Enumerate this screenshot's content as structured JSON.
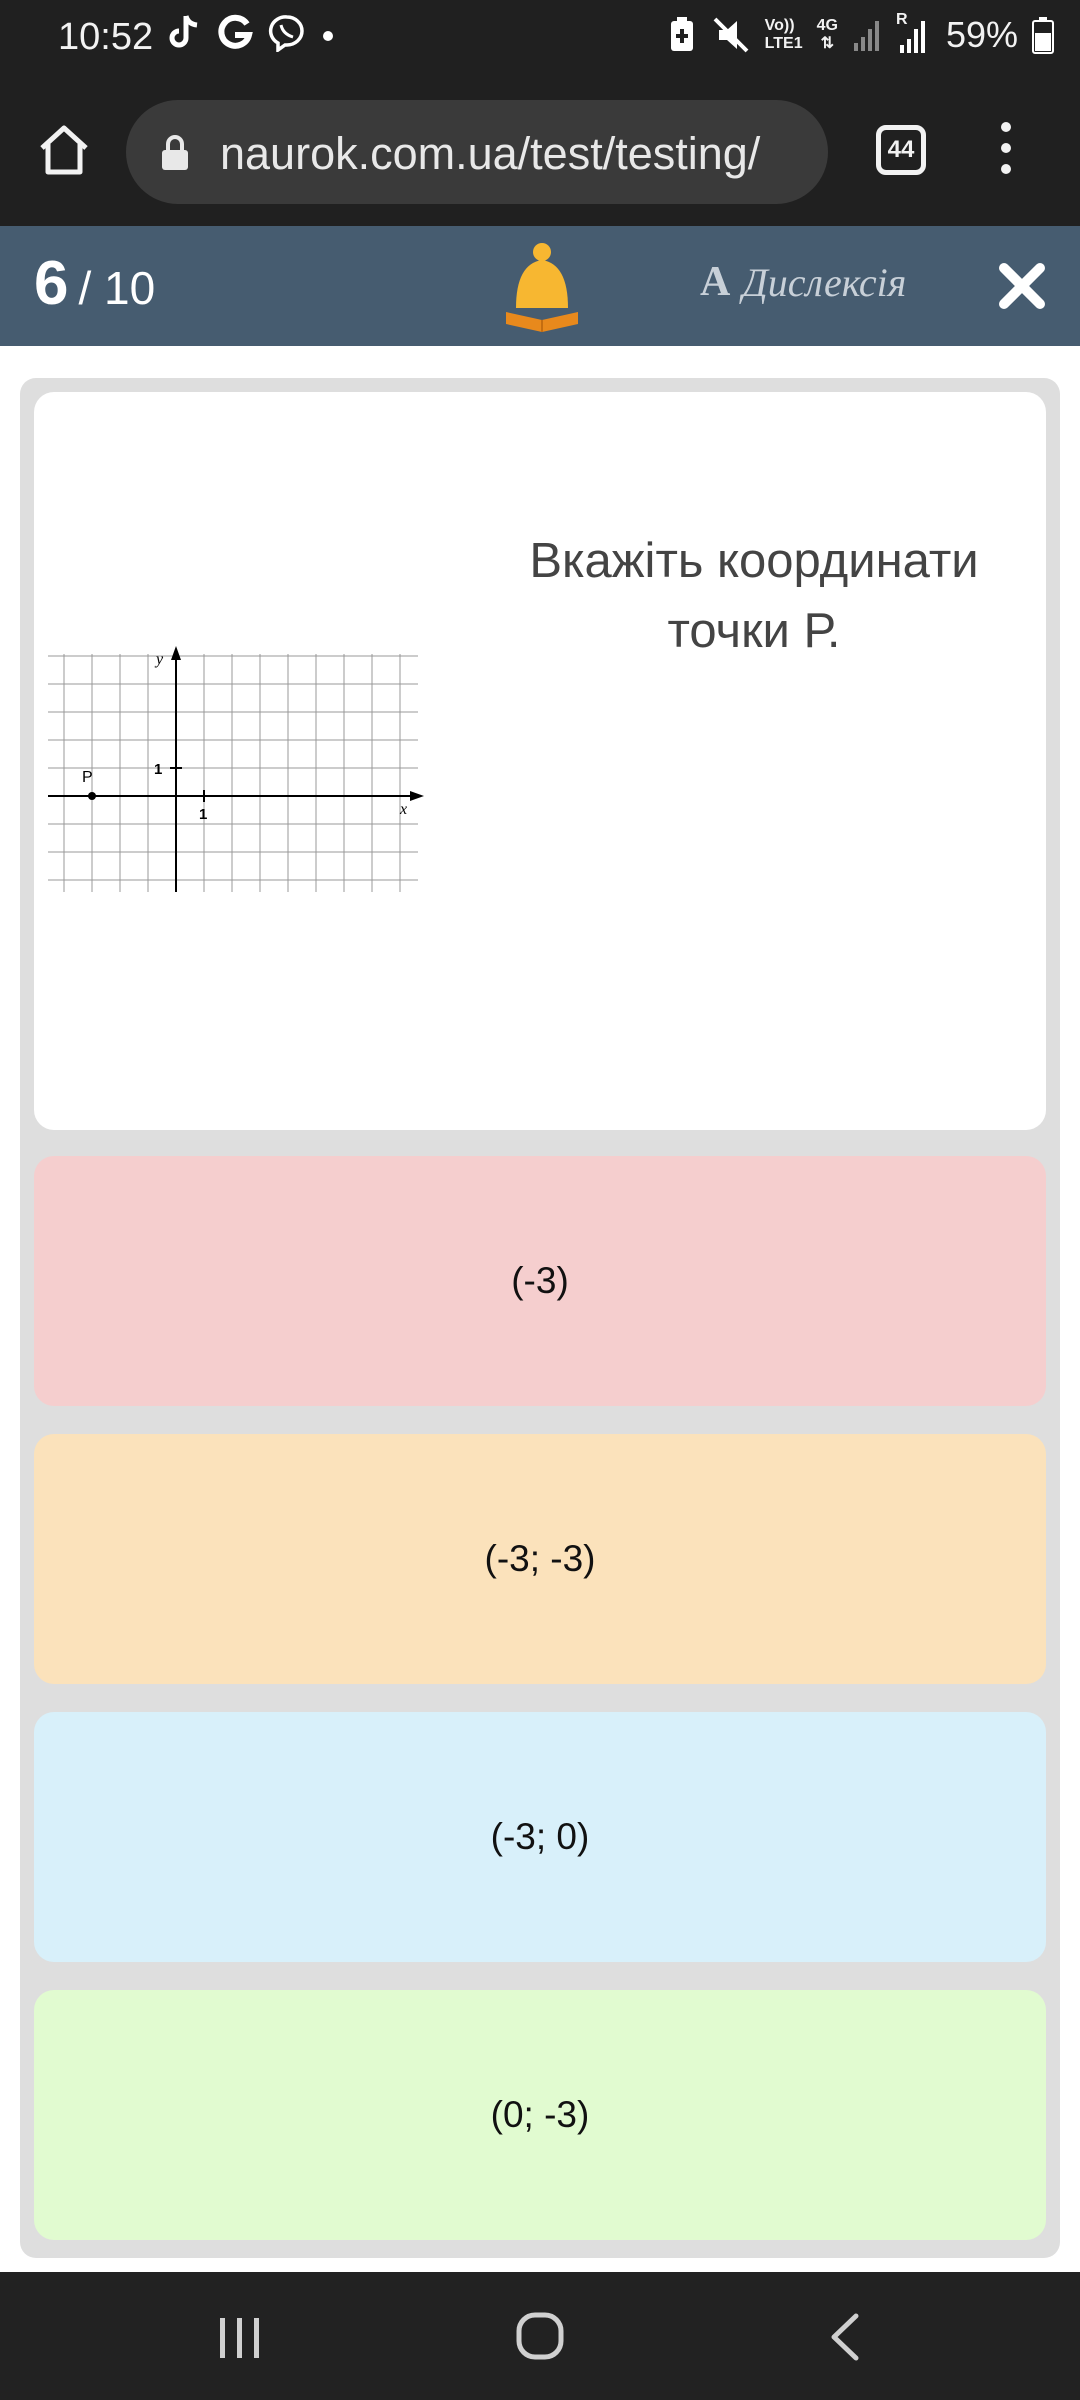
{
  "status_bar": {
    "time": "10:52",
    "battery": "59%",
    "network_top": "Vo))",
    "network_bottom": "LTE1",
    "gen": "4G",
    "roaming": "R"
  },
  "browser": {
    "url": "naurok.com.ua/test/testing/",
    "tab_count": "44"
  },
  "quiz": {
    "current": "6",
    "total": "/ 10",
    "dyslexia_glyph": "A",
    "dyslexia_label": "Дислексія",
    "question": "Вкажіть координати точки Р.",
    "graph": {
      "point_label": "P",
      "y_axis_label": "y",
      "x_axis_label": "x",
      "y_tick_label": "1",
      "x_tick_label": "1"
    },
    "answers": [
      "(-3)",
      "(-3; -3)",
      "(-3; 0)",
      "(0; -3)"
    ]
  },
  "colors": {
    "header": "#465c70",
    "bell": "#f7b731",
    "answer_1": "#f5cece",
    "answer_2": "#fbe2bb",
    "answer_3": "#d8f0fa",
    "answer_4": "#e1fbd0"
  }
}
